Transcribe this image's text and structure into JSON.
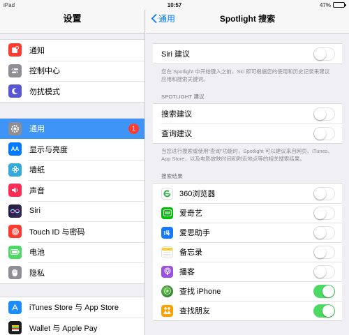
{
  "status_bar": {
    "device": "iPad",
    "time": "10:57",
    "battery_text": "47%",
    "battery_level": 0.47
  },
  "sidebar": {
    "title": "设置",
    "groups": [
      [
        {
          "label": "通知",
          "icon": "notifications-icon",
          "color": "#ff3b30"
        },
        {
          "label": "控制中心",
          "icon": "control-center-icon",
          "color": "#8e8e93"
        },
        {
          "label": "勿扰模式",
          "icon": "moon-icon",
          "color": "#5856d6"
        }
      ],
      [
        {
          "label": "通用",
          "icon": "gear-icon",
          "color": "#8e8e93",
          "selected": true,
          "badge": "1"
        },
        {
          "label": "显示与亮度",
          "icon": "display-brightness-icon",
          "color": "#007aff"
        },
        {
          "label": "墙纸",
          "icon": "wallpaper-icon",
          "color": "#34aadc"
        },
        {
          "label": "声音",
          "icon": "speaker-icon",
          "color": "#ff2d55"
        },
        {
          "label": "Siri",
          "icon": "siri-icon",
          "color": "#222222"
        },
        {
          "label": "Touch ID 与密码",
          "icon": "fingerprint-icon",
          "color": "#ff3b30"
        },
        {
          "label": "电池",
          "icon": "battery-icon",
          "color": "#4cd964"
        },
        {
          "label": "隐私",
          "icon": "hand-icon",
          "color": "#8e8e93"
        }
      ],
      [
        {
          "label": "iTunes Store 与 App Store",
          "icon": "app-store-icon",
          "color": "#1a8cff"
        },
        {
          "label": "Wallet 与 Apple Pay",
          "icon": "wallet-icon",
          "color": "#1c1c1e"
        }
      ]
    ]
  },
  "main": {
    "back_label": "通用",
    "title": "Spotlight 搜索",
    "siri_suggestions": {
      "label": "Siri 建议",
      "on": false,
      "footnote": "您在 Spotlight 中开始键入之前，Siri 即可根据您的使用和历史记录来建议应用和搜索关键词。"
    },
    "spotlight_section": {
      "header": "SPOTLIGHT 建议",
      "rows": [
        {
          "label": "搜索建议",
          "on": false
        },
        {
          "label": "查询建议",
          "on": false
        }
      ],
      "footnote": "当您进行搜索或使用“查询”功能时，Spotlight 可以建议来自网页、iTunes、App Store，以及电影放映时间和附近地点等的相关搜索结果。"
    },
    "results_section": {
      "header": "搜索结果",
      "apps": [
        {
          "label": "360浏览器",
          "icon": "browser-360-icon",
          "color": "#ffffff",
          "on": false
        },
        {
          "label": "爱奇艺",
          "icon": "iqiyi-icon",
          "color": "#00be06",
          "on": false
        },
        {
          "label": "爱思助手",
          "icon": "i4-assistant-icon",
          "color": "#1677ff",
          "on": false
        },
        {
          "label": "备忘录",
          "icon": "notes-icon",
          "color": "#ffffff",
          "on": false
        },
        {
          "label": "播客",
          "icon": "podcasts-icon",
          "color": "#9b51e0",
          "on": false
        },
        {
          "label": "查找 iPhone",
          "icon": "find-iphone-icon",
          "color": "#2e7d32",
          "on": true
        },
        {
          "label": "查找朋友",
          "icon": "find-friends-icon",
          "color": "#ffa000",
          "on": true
        }
      ]
    }
  }
}
